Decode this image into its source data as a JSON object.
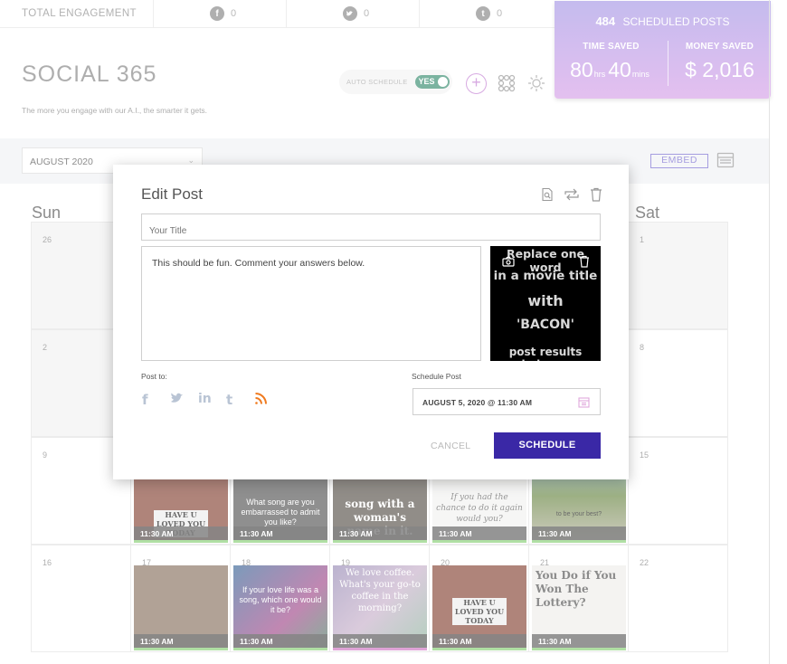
{
  "engagement": {
    "label": "TOTAL ENGAGEMENT",
    "items": [
      {
        "icon": "facebook-icon",
        "glyph": "f",
        "count": "0"
      },
      {
        "icon": "twitter-icon",
        "glyph": "t",
        "count": "0"
      },
      {
        "icon": "tumblr-icon",
        "glyph": "t",
        "count": "0"
      }
    ]
  },
  "stats": {
    "scheduled_count": "484",
    "scheduled_label": "SCHEDULED POSTS",
    "time_label": "TIME SAVED",
    "time_hours": "80",
    "time_hours_unit": "hrs",
    "time_mins": "40",
    "time_mins_unit": "mins",
    "money_label": "MONEY SAVED",
    "money_value": "$ 2,016"
  },
  "header": {
    "title": "SOCIAL 365",
    "subtitle": "The more you engage with our A.I., the smarter it gets.",
    "auto_schedule_label": "AUTO SCHEDULE",
    "auto_schedule_value": "YES"
  },
  "toolbar": {
    "month": "AUGUST 2020",
    "embed_label": "EMBED"
  },
  "calendar": {
    "days_of_week_visible": [
      "Sun",
      "Sat"
    ],
    "dates_visible": [
      "26",
      "1",
      "2",
      "8",
      "9",
      "15",
      "16",
      "17",
      "18",
      "19",
      "20",
      "21",
      "22"
    ],
    "post_time": "11:30 AM",
    "thumbnails": {
      "row3": [
        "HAVE U LOVED YOU TODAY",
        "What song are you embarrassed to admit you like?",
        "song with a woman's name in it.",
        "If you had the chance to do it again would you?",
        "to be your best?"
      ],
      "row4": [
        "",
        "If your love life was a song, which one would it be?",
        "We love coffee. What's your go-to coffee in the morning?",
        "HAVE U LOVED YOU TODAY",
        "You Do if You Won The Lottery?"
      ]
    }
  },
  "modal": {
    "title": "Edit Post",
    "title_placeholder": "Your Title",
    "body": "This should be fun. Comment your answers below.",
    "image_lines": [
      "Replace one word",
      "in a movie title",
      "with",
      "'BACON'",
      "post results below..."
    ],
    "post_to_label": "Post to:",
    "networks": [
      "facebook",
      "twitter",
      "linkedin",
      "tumblr",
      "rss"
    ],
    "schedule_label": "Schedule Post",
    "schedule_value": "AUGUST 5, 2020 @ 11:30 AM",
    "cancel_label": "CANCEL",
    "schedule_button": "SCHEDULE"
  },
  "colors": {
    "accent": "#3a28a6",
    "toggle_on": "#3d8f73",
    "stats_gradient_top": "#a99be6",
    "stats_gradient_bottom": "#d7a2e8",
    "status_strip": "#8bd07a"
  }
}
